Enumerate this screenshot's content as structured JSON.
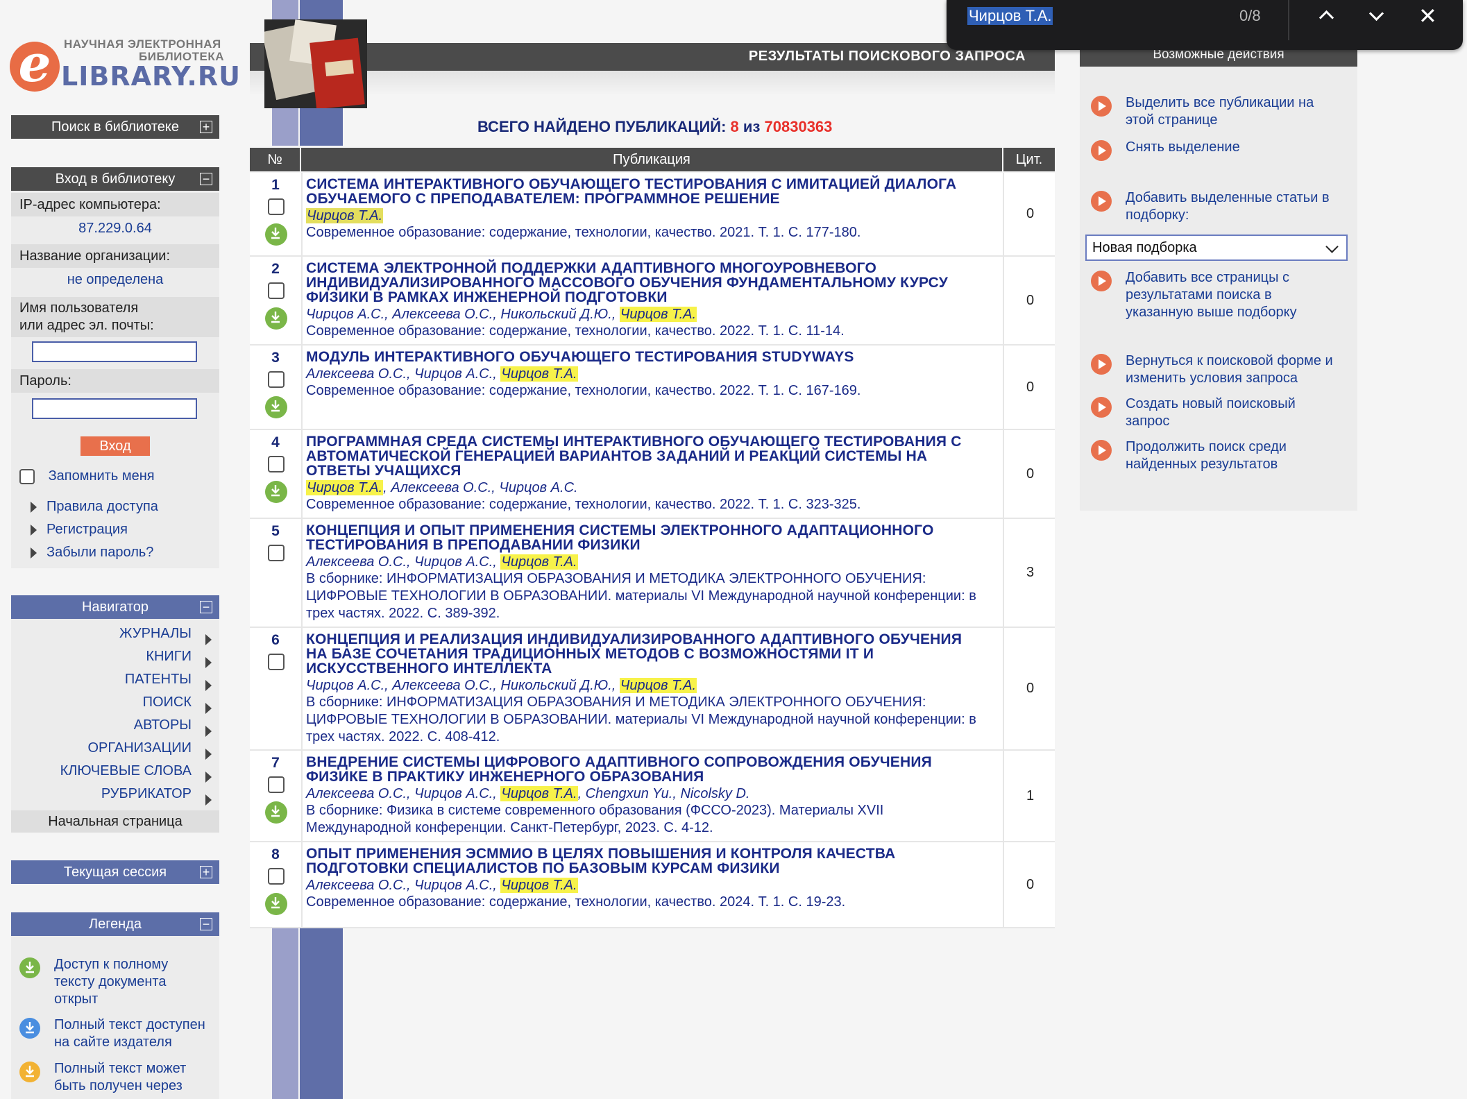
{
  "logo": {
    "line1": "НАУЧНАЯ ЭЛЕКТРОННАЯ",
    "line2": "БИБЛИОТЕКА",
    "line3": "LIBRARY.RU",
    "letter": "e"
  },
  "sidebar": {
    "search_library": "Поиск в библиотеке",
    "login_header": "Вход в библиотеку",
    "ip_label": "IP-адрес компьютера:",
    "ip_value": "87.229.0.64",
    "org_label": "Название организации:",
    "org_value": "не определена",
    "user_label_1": "Имя пользователя",
    "user_label_2": "или адрес эл. почты:",
    "password_label": "Пароль:",
    "login_button": "Вход",
    "remember_me": "Запомнить меня",
    "links": [
      "Правила доступа",
      "Регистрация",
      "Забыли пароль?"
    ],
    "navigator_header": "Навигатор",
    "nav_items": [
      "ЖУРНАЛЫ",
      "КНИГИ",
      "ПАТЕНТЫ",
      "ПОИСК",
      "АВТОРЫ",
      "ОРГАНИЗАЦИИ",
      "КЛЮЧЕВЫЕ СЛОВА",
      "РУБРИКАТОР"
    ],
    "home_page": "Начальная страница",
    "session_header": "Текущая сессия",
    "legend_header": "Легенда",
    "legend": [
      {
        "icon": "download-green-icon",
        "color": "#7ab648",
        "lines": [
          "Доступ к полному",
          "тексту документа",
          "открыт"
        ]
      },
      {
        "icon": "download-blue-icon",
        "color": "#4a8ee0",
        "lines": [
          "Полный текст доступен",
          "на сайте издателя"
        ]
      },
      {
        "icon": "download-orange-icon",
        "color": "#f2b233",
        "lines": [
          "Полный текст может",
          "быть получен через"
        ]
      }
    ]
  },
  "header": {
    "title": "РЕЗУЛЬТАТЫ ПОИСКОВОГО ЗАПРОСА",
    "total_label": "ВСЕГО НАЙДЕНО ПУБЛИКАЦИЙ:",
    "total_found": "8",
    "total_of": "из",
    "total_all": "70830363"
  },
  "table": {
    "col_num": "№",
    "col_pub": "Публикация",
    "col_cit": "Цит.",
    "rows": [
      {
        "num": "1",
        "title": [
          "СИСТЕМА ИНТЕРАКТИВНОГО ОБУЧАЮЩЕГО ТЕСТИРОВАНИЯ С ИМИТАЦИЕЙ ДИАЛОГА",
          "ОБУЧАЕМОГО С ПРЕПОДАВАТЕЛЕМ: ПРОГРАММНОЕ РЕШЕНИЕ"
        ],
        "authors_pre": "",
        "highlight": "Чирцов Т.А.",
        "authors_post": "",
        "source": [
          "Современное образование: содержание, технологии, качество. 2021. Т. 1. С. 177-180."
        ],
        "citations": "0"
      },
      {
        "num": "2",
        "title": [
          "СИСТЕМА ЭЛЕКТРОННОЙ ПОДДЕРЖКИ АДАПТИВНОГО МНОГОУРОВНЕВОГО",
          "ИНДИВИДУАЛИЗИРОВАННОГО МАССОВОГО ОБУЧЕНИЯ ФУНДАМЕНТАЛЬНОМУ КУРСУ",
          "ФИЗИКИ В РАМКАХ ИНЖЕНЕРНОЙ ПОДГОТОВКИ"
        ],
        "authors_pre": "Чирцов А.С., Алексеева О.С., Никольский Д.Ю., ",
        "highlight": "Чирцов Т.А.",
        "authors_post": "",
        "source": [
          "Современное образование: содержание, технологии, качество. 2022. Т. 1. С. 11-14."
        ],
        "citations": "0"
      },
      {
        "num": "3",
        "title": [
          "МОДУЛЬ ИНТЕРАКТИВНОГО ОБУЧАЮЩЕГО ТЕСТИРОВАНИЯ STUDYWAYS"
        ],
        "authors_pre": "Алексеева О.С., Чирцов А.С., ",
        "highlight": "Чирцов Т.А.",
        "authors_post": "",
        "source": [
          "Современное образование: содержание, технологии, качество. 2022. Т. 1. С. 167-169."
        ],
        "citations": "0"
      },
      {
        "num": "4",
        "title": [
          "ПРОГРАММНАЯ СРЕДА СИСТЕМЫ ИНТЕРАКТИВНОГО ОБУЧАЮЩЕГО ТЕСТИРОВАНИЯ С",
          "АВТОМАТИЧЕСКОЙ ГЕНЕРАЦИЕЙ ВАРИАНТОВ ЗАДАНИЙ И РЕАКЦИЙ СИСТЕМЫ НА",
          "ОТВЕТЫ УЧАЩИХСЯ"
        ],
        "authors_pre": "",
        "highlight": "Чирцов Т.А.",
        "authors_post": ", Алексеева О.С., Чирцов А.С.",
        "source": [
          "Современное образование: содержание, технологии, качество. 2022. Т. 1. С. 323-325."
        ],
        "citations": "0"
      },
      {
        "num": "5",
        "title": [
          "КОНЦЕПЦИЯ И ОПЫТ ПРИМЕНЕНИЯ СИСТЕМЫ ЭЛЕКТРОННОГО АДАПТАЦИОННОГО",
          "ТЕСТИРОВАНИЯ В ПРЕПОДАВАНИИ ФИЗИКИ"
        ],
        "authors_pre": "Алексеева О.С., Чирцов А.С., ",
        "highlight": "Чирцов Т.А.",
        "authors_post": "",
        "source": [
          "В сборнике: ИНФОРМАТИЗАЦИЯ ОБРАЗОВАНИЯ И МЕТОДИКА ЭЛЕКТРОННОГО ОБУЧЕНИЯ:",
          "ЦИФРОВЫЕ ТЕХНОЛОГИИ В ОБРАЗОВАНИИ. материалы VI Международной научной конференции: в",
          "трех частях. 2022. С. 389-392."
        ],
        "citations": "3"
      },
      {
        "num": "6",
        "title": [
          "КОНЦЕПЦИЯ И РЕАЛИЗАЦИЯ ИНДИВИДУАЛИЗИРОВАННОГО АДАПТИВНОГО ОБУЧЕНИЯ",
          "НА БАЗЕ СОЧЕТАНИЯ ТРАДИЦИОННЫХ МЕТОДОВ С ВОЗМОЖНОСТЯМИ IT И",
          "ИСКУССТВЕННОГО ИНТЕЛЛЕКТА"
        ],
        "authors_pre": "Чирцов А.С., Алексеева О.С., Никольский Д.Ю., ",
        "highlight": "Чирцов Т.А.",
        "authors_post": "",
        "source": [
          "В сборнике: ИНФОРМАТИЗАЦИЯ ОБРАЗОВАНИЯ И МЕТОДИКА ЭЛЕКТРОННОГО ОБУЧЕНИЯ:",
          "ЦИФРОВЫЕ ТЕХНОЛОГИИ В ОБРАЗОВАНИИ. материалы VI Международной научной конференции: в",
          "трех частях. 2022. С. 408-412."
        ],
        "citations": "0"
      },
      {
        "num": "7",
        "title": [
          "ВНЕДРЕНИЕ СИСТЕМЫ ЦИФРОВОГО АДАПТИВНОГО СОПРОВОЖДЕНИЯ ОБУЧЕНИЯ",
          "ФИЗИКЕ В ПРАКТИКУ ИНЖЕНЕРНОГО ОБРАЗОВАНИЯ"
        ],
        "authors_pre": "Алексеева О.С., Чирцов А.С., ",
        "highlight": "Чирцов Т.А.",
        "authors_post": ", Chengxun Yu., Nicolsky D.",
        "source": [
          "В сборнике: Физика в системе современного образования (ФССО-2023). Материалы XVII",
          "Международной конференции. Санкт-Петербург, 2023. С. 4-12."
        ],
        "citations": "1"
      },
      {
        "num": "8",
        "title": [
          "ОПЫТ ПРИМЕНЕНИЯ ЭСММИО В ЦЕЛЯХ ПОВЫШЕНИЯ И КОНТРОЛЯ КАЧЕСТВА",
          "ПОДГОТОВКИ СПЕЦИАЛИСТОВ ПО БАЗОВЫМ КУРСАМ ФИЗИКИ"
        ],
        "authors_pre": "Алексеева О.С., Чирцов А.С., ",
        "highlight": "Чирцов Т.А.",
        "authors_post": "",
        "source": [
          "Современное образование: содержание, технологии, качество. 2024. Т. 1. С. 19-23."
        ],
        "citations": "0"
      }
    ]
  },
  "actions": {
    "header": "Возможные действия",
    "items": [
      [
        "Выделить все публикации на",
        "этой странице"
      ],
      [
        "Снять выделение"
      ],
      [
        "Добавить выделенные статьи в",
        "подборку:"
      ],
      [
        "Добавить все страницы с",
        "результатами поиска в",
        "указанную выше подборку"
      ],
      [
        "Вернуться к поисковой форме и",
        "изменить условия запроса"
      ],
      [
        "Создать новый поисковый",
        "запрос"
      ],
      [
        "Продолжить поиск среди",
        "найденных результатов"
      ]
    ],
    "select_value": "Новая подборка"
  },
  "findbar": {
    "query": "Чирцов Т.А.",
    "count": "0/8"
  },
  "colors": {
    "accent_blue": "#5c6ea8",
    "dark_header": "#4b4b4b",
    "link": "#1a3d94",
    "highlight": "#f7f24a",
    "action_icon": "#e8704c",
    "red": "#e8302a"
  }
}
